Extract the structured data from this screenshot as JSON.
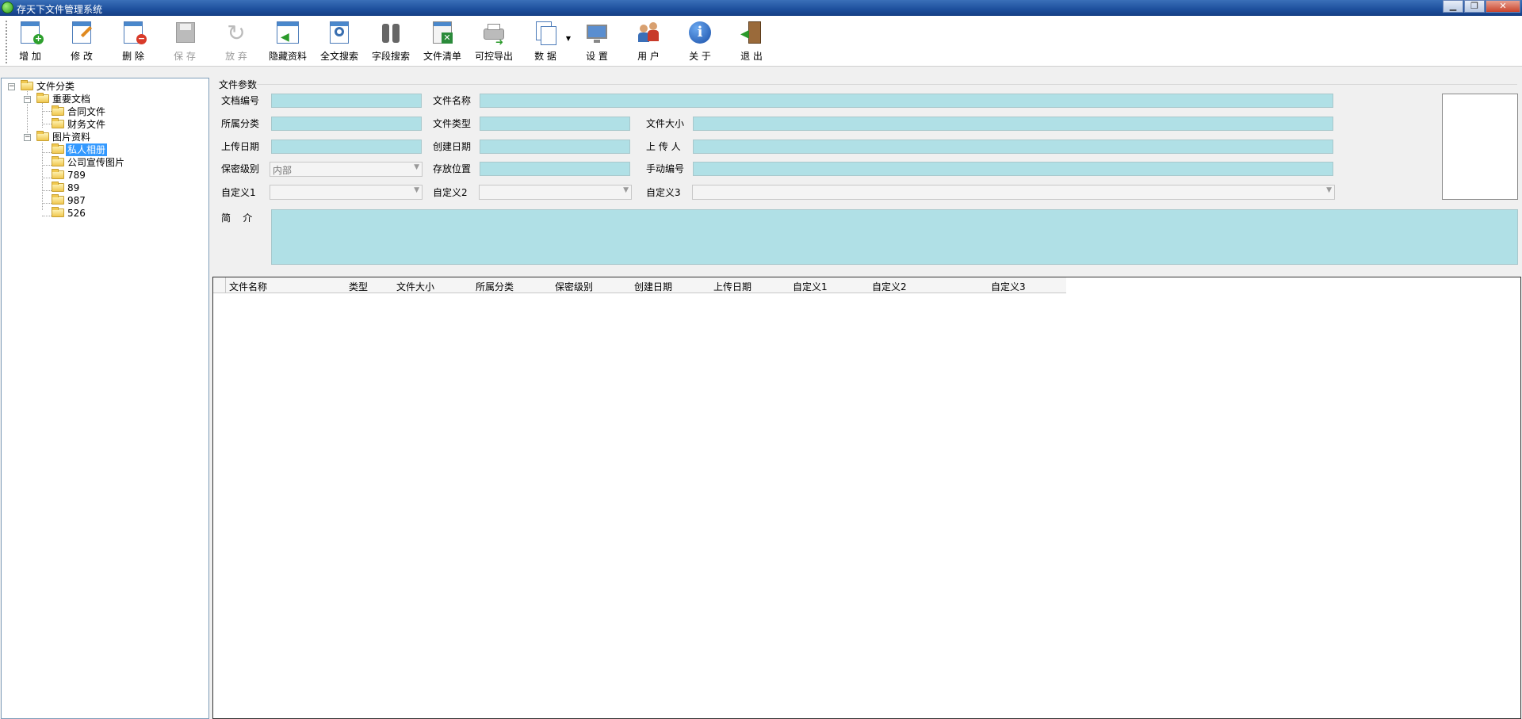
{
  "window": {
    "title": "存天下文件管理系统",
    "min": "▁",
    "max": "❐",
    "close": "✕"
  },
  "toolbar": {
    "add": "增 加",
    "edit": "修 改",
    "delete": "删 除",
    "save": "保 存",
    "discard": "放 弃",
    "hide": "隐藏资料",
    "fulltext": "全文搜索",
    "field_search": "字段搜索",
    "file_list": "文件清单",
    "export": "可控导出",
    "data": "数 据",
    "settings": "设 置",
    "users": "用 户",
    "about": "关 于",
    "exit": "退 出"
  },
  "tree": {
    "root": "文件分类",
    "n1": "重要文档",
    "n1a": "合同文件",
    "n1b": "财务文件",
    "n2": "图片资料",
    "n2a": "私人相册",
    "n2b": "公司宣传图片",
    "n2c": "789",
    "n2d": "89",
    "n2e": "987",
    "n2f": "526"
  },
  "params": {
    "title": "文件参数",
    "doc_no": "文档编号",
    "file_name": "文件名称",
    "category": "所属分类",
    "file_type": "文件类型",
    "file_size": "文件大小",
    "upload_date": "上传日期",
    "create_date": "创建日期",
    "uploader": "上 传 人",
    "secrecy": "保密级别",
    "secrecy_value": "内部",
    "location": "存放位置",
    "manual_no": "手动编号",
    "custom1": "自定义1",
    "custom2": "自定义2",
    "custom3": "自定义3",
    "summary": "简    介"
  },
  "grid": {
    "columns": [
      "文件名称",
      "类型",
      "文件大小",
      "所属分类",
      "保密级别",
      "创建日期",
      "上传日期",
      "自定义1",
      "自定义2",
      "自定义3"
    ]
  },
  "colors": {
    "field_bg": "#b0e0e6",
    "titlebar": "#1d4f9c",
    "selection": "#3399ff"
  }
}
